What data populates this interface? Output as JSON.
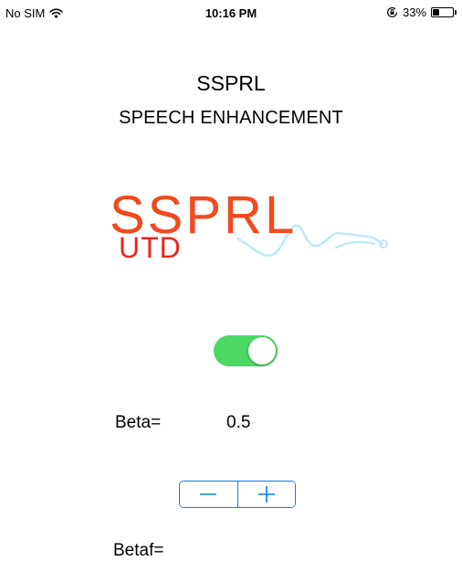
{
  "status_bar": {
    "carrier": "No SIM",
    "time": "10:16 PM",
    "battery_text": "33%",
    "battery_level": 0.33,
    "icons": [
      "wifi-icon",
      "orientation-lock-icon",
      "battery-icon"
    ]
  },
  "header": {
    "title": "SSPRL",
    "subtitle": "SPEECH ENHANCEMENT"
  },
  "logo": {
    "main_text": "SSPRL",
    "sub_text": "UTD",
    "colors": {
      "main": "#f04a1e",
      "sub": "#e8251c",
      "wave": "#bfe9f7"
    }
  },
  "controls": {
    "toggle": {
      "on": true,
      "on_color": "#4cd964"
    },
    "beta": {
      "label": "Beta=",
      "value": "0.5"
    },
    "stepper": {
      "minus_icon": "minus-icon",
      "plus_icon": "plus-icon",
      "tint": "#0a7bff"
    },
    "betaf": {
      "label": "Betaf="
    }
  }
}
